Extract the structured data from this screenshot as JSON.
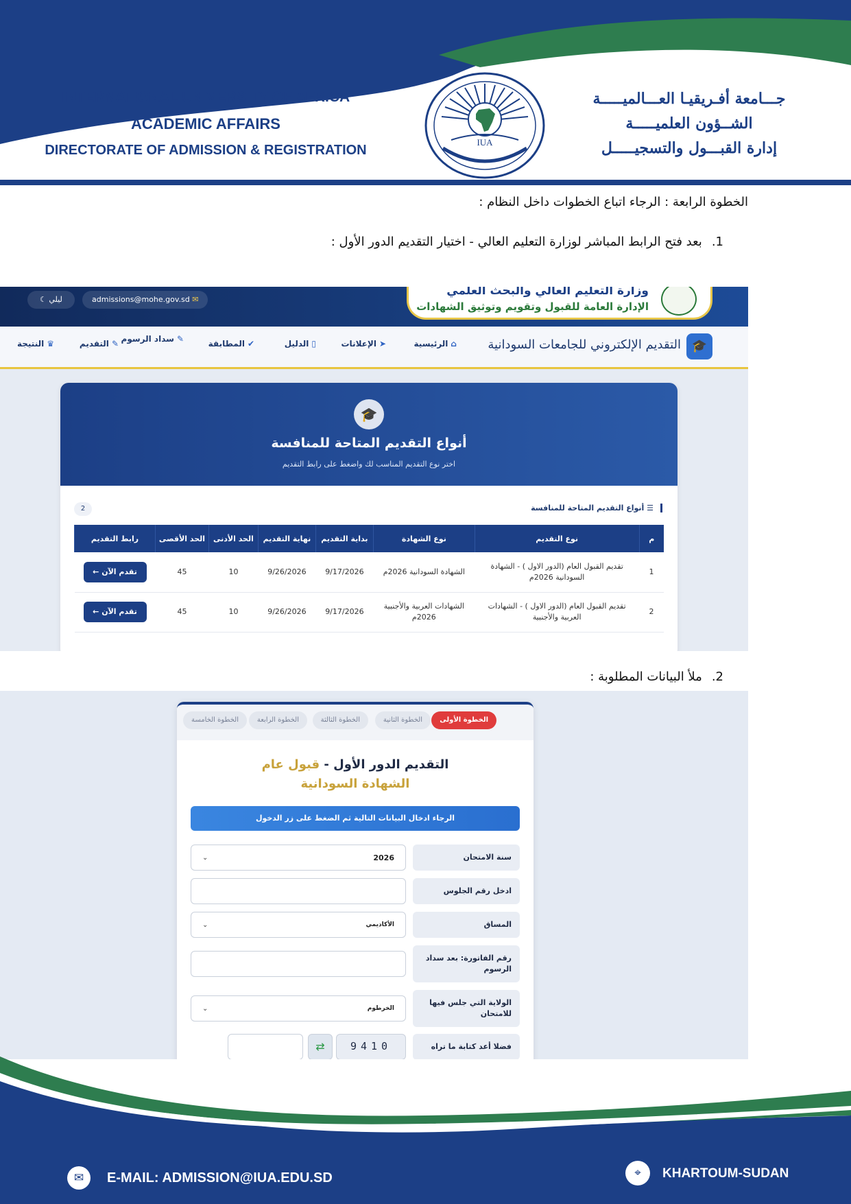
{
  "letterhead": {
    "en_line1": "INTERNATIONAL UNIVERSITY OF AFRICA",
    "en_line2": "ACADEMIC AFFAIRS",
    "en_line3": "DIRECTORATE OF ADMISSION & REGISTRATION",
    "ar_line1": "جـــامعة أفـريقيـا العـــالميـــــة",
    "ar_line2": "الشــؤون العلميـــــة",
    "ar_line3": "إدارة القبـــول والتسجيـــــل",
    "seal_text": "IUA",
    "colors": {
      "navy": "#1c3f86",
      "green": "#2e7d4f"
    }
  },
  "document": {
    "step_heading": "الخطوة الرابعة : الرجاء اتباع الخطوات داخل النظام :",
    "item1_number": "1.",
    "item1_text": "بعد فتح الرابط المباشر لوزارة التعليم العالي - اختيار التقديم الدور الأول :",
    "item2_number": "2.",
    "item2_text": "ملأ البيانات المطلوبة :"
  },
  "portal": {
    "email_pill": "admissions@mohe.gov.sd",
    "lang_pill": "ليلي",
    "ministry_line1": "وزارة التعليم العالي والبحث العلمي",
    "ministry_line2": "الإدارة العامة للقبول وتقويم وتوثيق الشهادات",
    "brand": "التقديم الإلكتروني للجامعات السودانية",
    "nav": [
      {
        "label": "الرئيسية",
        "icon": "home-icon"
      },
      {
        "label": "الإعلانات",
        "icon": "megaphone-icon"
      },
      {
        "label": "الدليل",
        "icon": "book-icon"
      },
      {
        "label": "المطابقة",
        "icon": "check-circle-icon"
      },
      {
        "label": "سداد الرسوم",
        "icon": "edit-icon"
      },
      {
        "label": "التقديم",
        "icon": "edit-icon"
      },
      {
        "label": "النتيجة",
        "icon": "trophy-icon"
      }
    ],
    "hero_title": "أنواع التقديم المتاحة للمنافسة",
    "hero_subtitle": "اختر نوع التقديم المناسب لك واضغط على رابط التقديم",
    "section_title": "أنواع التقديم المتاحة للمنافسة",
    "count": "2",
    "table": {
      "headers": [
        "م",
        "نوع التقديم",
        "نوع الشهادة",
        "بداية التقديم",
        "نهاية التقديم",
        "الحد الأدنى",
        "الحد الأقصى",
        "رابط التقديم"
      ],
      "rows": [
        {
          "n": "1",
          "type": "تقديم القبول العام (الدور الاول ) - الشهادة السودانية 2026م",
          "cert": "الشهادة السودانية 2026م",
          "start": "9/17/2026",
          "end": "9/26/2026",
          "min": "10",
          "max": "45",
          "action": "تقدم الآن ←"
        },
        {
          "n": "2",
          "type": "تقديم القبول العام (الدور الاول ) - الشهادات العربية والأجنبية",
          "cert": "الشهادات العربية والأجنبية 2026م",
          "start": "9/17/2026",
          "end": "9/26/2026",
          "min": "10",
          "max": "45",
          "action": "تقدم الآن ←"
        }
      ]
    }
  },
  "form": {
    "steps": [
      "الخطوة الأولى",
      "الخطوة الثانية",
      "الخطوة الثالثة",
      "الخطوة الرابعة",
      "الخطوة الخامسة"
    ],
    "title_part1": "التقديم الدور الأول - ",
    "title_part2": "قبول عام",
    "title_line2": "الشهادة السودانية",
    "notice": "الرجاء ادخال البيانات التالية ثم الضغط على زر الدخول",
    "fields": [
      {
        "label": "سنة الامتحان",
        "value": "2026",
        "type": "select"
      },
      {
        "label": "ادخل رقم الجلوس",
        "value": "",
        "type": "text"
      },
      {
        "label": "المساق",
        "value": "الأكاديمي",
        "type": "select"
      },
      {
        "label": "رقم الفاتورة: بعد سداد الرسوم",
        "value": "",
        "type": "text"
      },
      {
        "label": "الولاية التي جلس فيها للامتحان",
        "value": "الخرطوم",
        "type": "select"
      }
    ],
    "captcha_label": "فضلا أعد كتابة ما تراه",
    "captcha_code": "9410"
  },
  "footer": {
    "email": "E-MAIL: ADMISSION@IUA.EDU.SD",
    "location": "KHARTOUM-SUDAN"
  }
}
